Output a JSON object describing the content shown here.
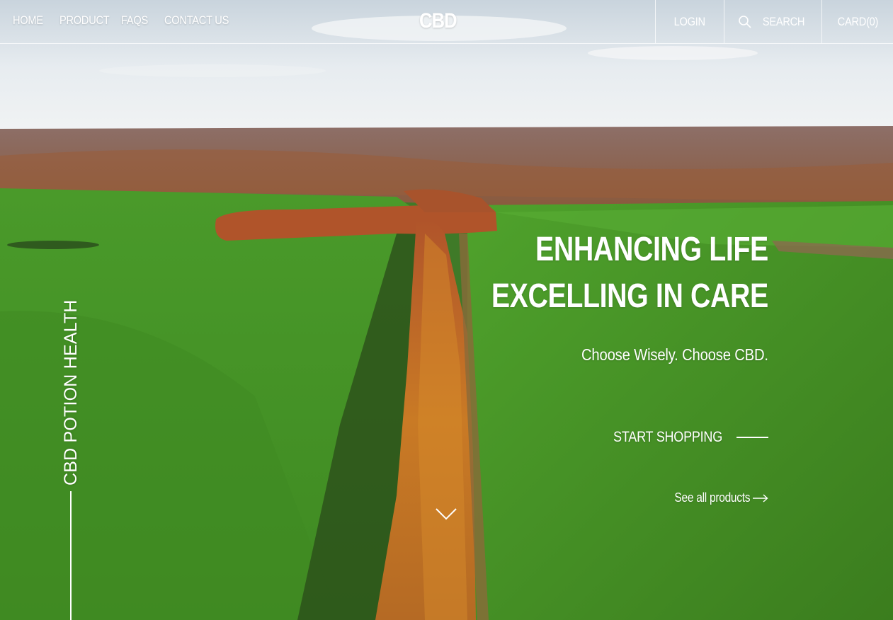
{
  "nav": {
    "links": [
      {
        "label": "HOME"
      },
      {
        "label": "PRODUCT"
      },
      {
        "label": "FAQS"
      },
      {
        "label": "CONTACT US"
      }
    ],
    "logo": "CBD",
    "login": "LOGIN",
    "search": "SEARCH",
    "cart": "CARD(0)"
  },
  "hero": {
    "side_brand": "CBD POTION HEALTH",
    "headline_line1": "ENHANCING LIFE",
    "headline_line2": "EXCELLING IN CARE",
    "tagline": "Choose Wisely. Choose CBD.",
    "cta": "START SHOPPING",
    "see_all": "See all products"
  },
  "colors": {
    "text": "#ffffff",
    "sky": "#dfe6ec",
    "field_green": "#4f9a2e",
    "autumn_trees": "#c2692a"
  },
  "icons": {
    "search": "search-icon",
    "arrow": "arrow-right-icon",
    "scroll": "chevron-down-icon"
  }
}
